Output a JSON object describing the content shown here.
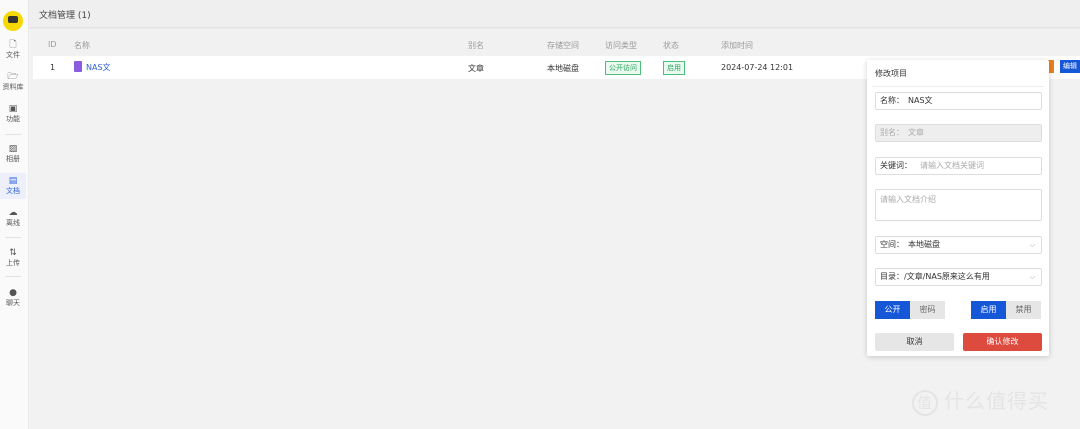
{
  "header": {
    "title": "文档管理 (1)"
  },
  "sidebar": {
    "items": [
      {
        "label": "文件",
        "icon": "file-icon",
        "glyph": "🗋"
      },
      {
        "label": "资料库",
        "icon": "folder-icon",
        "glyph": "🗁"
      },
      {
        "label": "功能",
        "icon": "layout-icon",
        "glyph": "▣"
      },
      {
        "label": "相册",
        "icon": "image-icon",
        "glyph": "▨"
      },
      {
        "label": "文档",
        "icon": "document-icon",
        "glyph": "▤"
      },
      {
        "label": "离线",
        "icon": "cloud-download-icon",
        "glyph": "☁"
      },
      {
        "label": "上传",
        "icon": "sort-arrows-icon",
        "glyph": "⇅"
      },
      {
        "label": "聊天",
        "icon": "chat-icon",
        "glyph": "●"
      }
    ]
  },
  "table": {
    "columns": [
      "ID",
      "名称",
      "别名",
      "存储空间",
      "访问类型",
      "状态",
      "添加时间"
    ],
    "rows": [
      {
        "id": "1",
        "name": "NAS文",
        "alias": "文章",
        "storage": "本地磁盘",
        "access": "公开访问",
        "status": "启用",
        "added": "2024-07-24 12:01",
        "edit": "编辑"
      }
    ]
  },
  "popup": {
    "title": "修改项目",
    "name_label": "名称：",
    "name_value": "NAS文",
    "alias_label": "别名：",
    "alias_value": "文章",
    "keyword_label": "关键词：",
    "keyword_placeholder": "请输入文档关键词",
    "intro_placeholder": "请输入文档介绍",
    "space_label": "空间：",
    "space_value": "本地磁盘",
    "dir_label": "目录：",
    "dir_value": "/文章/NAS原来这么有用",
    "access_options": [
      "公开",
      "密码"
    ],
    "status_options": [
      "启用",
      "禁用"
    ],
    "cancel": "取消",
    "confirm": "确认修改"
  },
  "watermark": {
    "logo": "值",
    "text": "什么值得买"
  }
}
